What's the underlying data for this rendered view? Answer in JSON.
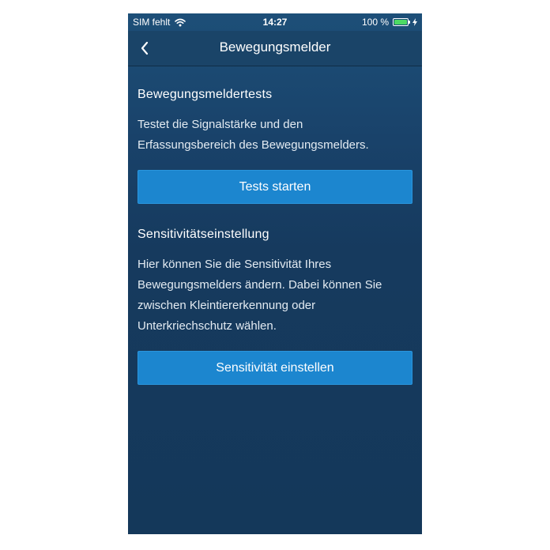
{
  "status_bar": {
    "carrier": "SIM fehlt",
    "wifi_icon": "wifi-icon",
    "time": "14:27",
    "battery_percent": "100 %",
    "battery_level": 1.0,
    "battery_icon": "battery-icon",
    "charging_icon": "charging-bolt-icon"
  },
  "nav": {
    "title": "Bewegungsmelder",
    "back_icon": "chevron-left-icon"
  },
  "sections": [
    {
      "heading": "Bewegungsmeldertests",
      "lines": [
        "Testet die Signalstärke und den",
        "Erfassungsbereich des Bewegungsmelders."
      ],
      "button": "Tests starten"
    },
    {
      "heading": "Sensitivitätseinstellung",
      "lines": [
        "Hier können Sie die Sensitivität Ihres",
        "Bewegungsmelders ändern. Dabei können Sie",
        "zwischen Kleintiererkennung oder",
        "Unterkriechschutz wählen."
      ],
      "button": "Sensitivität einstellen"
    }
  ],
  "colors": {
    "background": "#163a5e",
    "nav_bar": "#1a4468",
    "button": "#1c86cf",
    "battery_fill": "#4cd964"
  }
}
